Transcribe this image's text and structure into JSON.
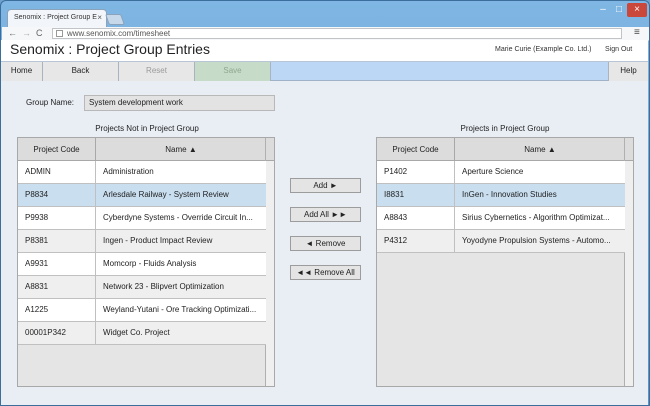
{
  "browser": {
    "tab_title": "Senomix : Project Group E",
    "tab_close": "×",
    "url": "www.senomix.com/timesheet",
    "controls": {
      "minimize": "–",
      "maximize": "□",
      "close": "×"
    },
    "nav": {
      "back": "←",
      "forward": "→",
      "reload": "C",
      "menu": "≡"
    }
  },
  "header": {
    "title": "Senomix : Project Group Entries",
    "user": "Marie Curie  (Example Co. Ltd.)",
    "sign_out": "Sign Out"
  },
  "buttons": {
    "home": "Home",
    "back": "Back",
    "reset": "Reset",
    "save": "Save",
    "help": "Help"
  },
  "group": {
    "label": "Group Name:",
    "value": "System development work"
  },
  "left_panel": {
    "title": "Projects Not in Project Group",
    "col_code": "Project Code",
    "col_name": "Name ▲",
    "rows": [
      {
        "code": "ADMIN",
        "name": "Administration"
      },
      {
        "code": "P8834",
        "name": "Arlesdale Railway - System Review",
        "selected": true
      },
      {
        "code": "P9938",
        "name": "Cyberdyne Systems - Override Circuit In..."
      },
      {
        "code": "P8381",
        "name": "Ingen - Product Impact Review"
      },
      {
        "code": "A9931",
        "name": "Momcorp - Fluids Analysis"
      },
      {
        "code": "A8831",
        "name": "Network 23 - Blipvert Optimization"
      },
      {
        "code": "A1225",
        "name": "Weyland-Yutani - Ore Tracking Optimizati..."
      },
      {
        "code": "00001P342",
        "name": "Widget Co. Project"
      }
    ]
  },
  "right_panel": {
    "title": "Projects in Project Group",
    "col_code": "Project Code",
    "col_name": "Name ▲",
    "rows": [
      {
        "code": "P1402",
        "name": "Aperture Science"
      },
      {
        "code": "I8831",
        "name": "InGen - Innovation Studies",
        "selected": true
      },
      {
        "code": "A8843",
        "name": "Sirius Cybernetics - Algorithm Optimizat..."
      },
      {
        "code": "P4312",
        "name": "Yoyodyne Propulsion Systems - Automo..."
      }
    ]
  },
  "actions": {
    "add": "Add ►",
    "add_all": "Add All ►►",
    "remove": "◄ Remove",
    "remove_all": "◄◄ Remove All"
  },
  "colors": {
    "selected_row": "#c9dff0",
    "even_row": "#ffffff",
    "odd_row": "#efefef",
    "button_bar": "#bcd6f6"
  }
}
